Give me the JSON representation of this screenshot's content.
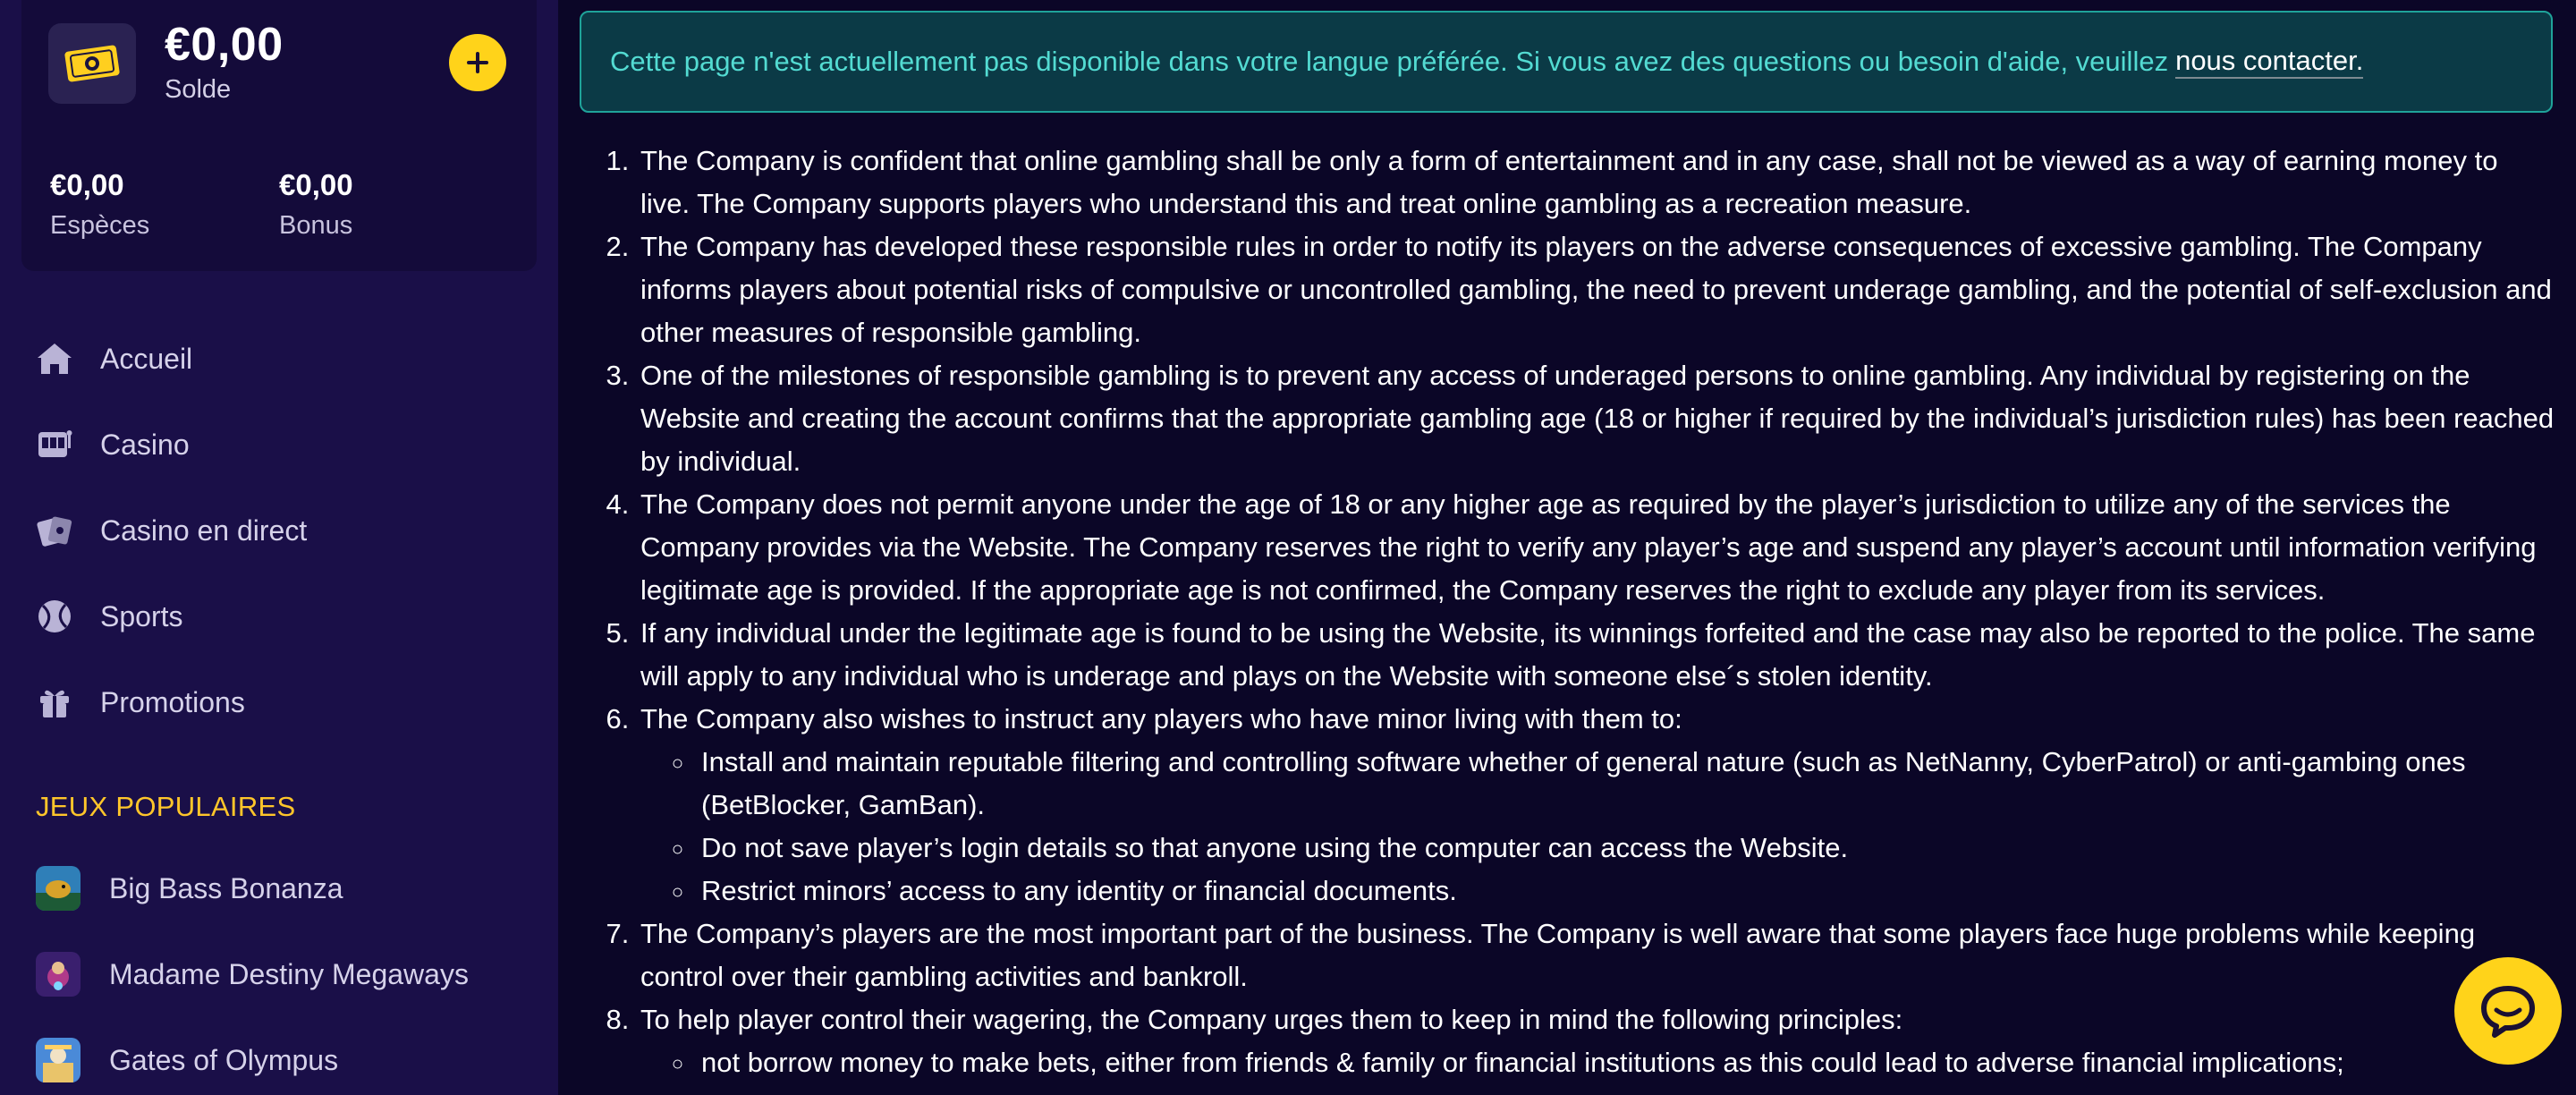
{
  "wallet": {
    "balance": "€0,00",
    "balance_label": "Solde",
    "cash_amount": "€0,00",
    "cash_label": "Espèces",
    "bonus_amount": "€0,00",
    "bonus_label": "Bonus",
    "deposit_icon": "plus-icon"
  },
  "nav": {
    "items": [
      {
        "label": "Accueil",
        "icon": "home-icon"
      },
      {
        "label": "Casino",
        "icon": "slot-machine-icon"
      },
      {
        "label": "Casino en direct",
        "icon": "cards-icon"
      },
      {
        "label": "Sports",
        "icon": "tennis-ball-icon"
      },
      {
        "label": "Promotions",
        "icon": "gift-icon"
      }
    ]
  },
  "popular": {
    "title": "JEUX POPULAIRES",
    "games": [
      {
        "label": "Big Bass Bonanza"
      },
      {
        "label": "Madame Destiny Megaways"
      },
      {
        "label": "Gates of Olympus"
      }
    ]
  },
  "notice": {
    "text": "Cette page n'est actuellement pas disponible dans votre langue préférée. Si vous avez des questions ou besoin d'aide, veuillez",
    "link": "nous contacter."
  },
  "rules": {
    "items": [
      "The Company is confident that online gambling shall be only a form of entertainment and in any case, shall not be viewed as a way of earning money to live. The Company supports players who understand this and treat online gambling as a recreation measure.",
      "The Company has developed these responsible rules in order to notify its players on the adverse consequences of excessive gambling. The Company informs players about potential risks of compulsive or uncontrolled gambling, the need to prevent underage gambling, and the potential of self-exclusion and other measures of responsible gambling.",
      "One of the milestones of responsible gambling is to prevent any access of underaged persons to online gambling. Any individual by registering on the Website and creating the account confirms that the appropriate gambling age (18 or higher if required by the individual’s jurisdiction rules) has been reached by individual.",
      "The Company does not permit anyone under the age of 18 or any higher age as required by the player’s jurisdiction to utilize any of the services the Company provides via the Website. The Company reserves the right to verify any player’s age and suspend any player’s account until information verifying legitimate age is provided. If the appropriate age is not confirmed, the Company reserves the right to exclude any player from its services.",
      "If any individual under the legitimate age is found to be using the Website, its winnings forfeited and the case may also be reported to the police. The same will apply to any individual who is underage and plays on the Website with someone else´s stolen identity.",
      "The Company also wishes to instruct any players who have minor living with them to:",
      "The Company’s players are the most important part of the business. The Company is well aware that some players face huge problems while keeping control over their gambling activities and bankroll.",
      "To help player control their wagering, the Company urges them to keep in mind the following principles:"
    ],
    "sub6": [
      "Install and maintain reputable filtering and controlling software whether of general nature (such as NetNanny, CyberPatrol) or anti-gambing ones (BetBlocker, GamBan).",
      "Do not save player’s login details so that anyone using the computer can access the Website.",
      "Restrict minors’ access to any identity or financial documents."
    ],
    "sub8": [
      "not borrow money to make bets, either from friends & family or financial institutions as this could lead to adverse financial implications;"
    ]
  },
  "chat": {
    "icon": "chat-bubble-icon"
  },
  "colors": {
    "accent": "#ffd31a",
    "sidebar_bg": "#1a0f48",
    "page_bg": "#0b0627",
    "notice_text": "#53dbd2",
    "section_title": "#ffc62a"
  }
}
